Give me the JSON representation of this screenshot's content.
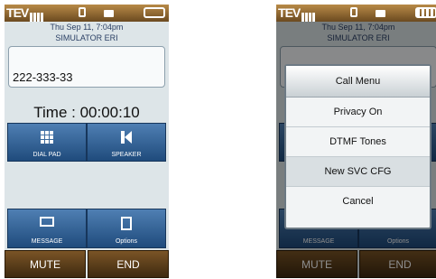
{
  "status_bar": {
    "signal": "T",
    "network": "EV",
    "battery_icon": "battery-icon"
  },
  "header": {
    "datetime": "Thu Sep 11, 7:04pm",
    "carrier": "SIMULATOR ERI"
  },
  "call": {
    "number": "222-333-33",
    "timer": "Time : 00:00:10"
  },
  "buttons": {
    "dialpad": {
      "label": "DIAL PAD",
      "icon": "dialpad-icon"
    },
    "speaker": {
      "label": "SPEAKER",
      "icon": "speaker-icon"
    },
    "message": {
      "label": "MESSAGE",
      "icon": "message-icon"
    },
    "options": {
      "label": "Options",
      "icon": "options-icon"
    },
    "mute": "MUTE",
    "end": "END"
  },
  "menu": {
    "title": "Call Menu",
    "items": [
      "Privacy On",
      "DTMF Tones",
      "New SVC CFG",
      "Cancel"
    ]
  }
}
